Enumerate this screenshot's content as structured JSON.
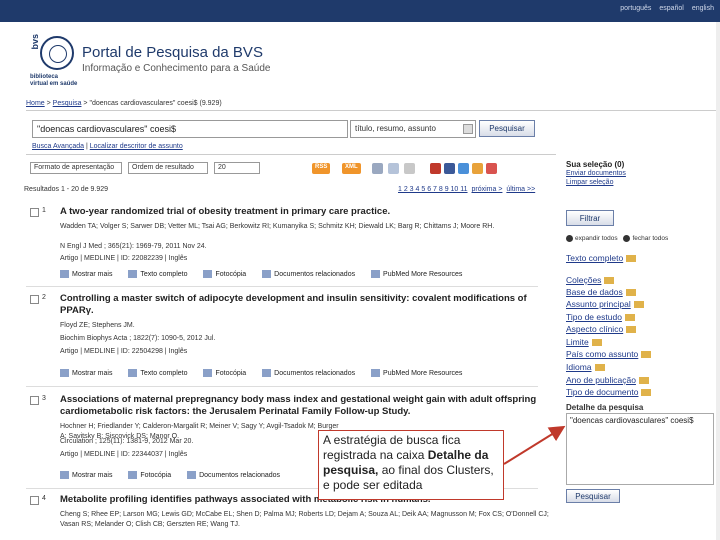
{
  "top": {
    "langs": [
      "português",
      "español",
      "english"
    ]
  },
  "header": {
    "logo_letters": "bvs",
    "logo_sub": [
      "biblioteca",
      "virtual em saúde"
    ],
    "title": "Portal de Pesquisa da BVS",
    "subtitle": "Informação e Conhecimento para a Saúde"
  },
  "breadcrumb": {
    "home": "Home",
    "pesquisa": "Pesquisa",
    "query_text": "> \"doencas cardiovasculares\" coesi$ (9.929)"
  },
  "search": {
    "value": "\"doencas cardiovasculares\" coesi$",
    "field_selected": "título, resumo, assunto",
    "button": "Pesquisar",
    "advanced": "Busca Avançada",
    "descriptor": "Localizar descritor de assunto"
  },
  "controls": {
    "format": "Formato de apresentação",
    "order": "Ordem de resultado",
    "per_page": "20",
    "rss": "RSS",
    "xml": "XML"
  },
  "results_count": "Resultados 1 - 20 de 9.929",
  "pager": {
    "pages": "1 2 3 4 5 6 7 8 9 10 11",
    "prev": "próxima >",
    "last": "última >>"
  },
  "results": [
    {
      "num": "1",
      "title": "A two-year randomized trial of obesity treatment in primary care practice.",
      "authors": "Wadden TA; Volger S; Sarwer DB; Vetter ML; Tsai AG; Berkowitz RI; Kumanyika S; Schmitz KH; Diewald LK; Barg R; Chittams J; Moore RH.",
      "journal": "N Engl J Med ; 365(21): 1969-79, 2011 Nov 24.",
      "meta": "Artigo | MEDLINE | ID: 22082239 | Inglês"
    },
    {
      "num": "2",
      "title": "Controlling a master switch of adipocyte development and insulin sensitivity: covalent modifications of PPARγ.",
      "authors": "Floyd ZE; Stephens JM.",
      "journal": "Biochim Biophys Acta ; 1822(7): 1090-5, 2012 Jul.",
      "meta": "Artigo | MEDLINE | ID: 22504298 | Inglês"
    },
    {
      "num": "3",
      "title": "Associations of maternal prepregnancy body mass index and gestational weight gain with adult offspring cardiometabolic risk factors: the Jerusalem Perinatal Family Follow-up Study.",
      "authors": "Hochner H; Friedlander Y; Calderon-Margalit R; Meiner V; Sagy Y; Avgil-Tsadok M; Burger A; Savitsky B; Siscovick DS; Manor O.",
      "journal": "Circulation ; 125(11): 1381-9, 2012 Mar 20.",
      "meta": "Artigo | MEDLINE | ID: 22344037 | Inglês"
    },
    {
      "num": "4",
      "title": "Metabolite profiling identifies pathways associated with metabolic risk in humans.",
      "authors": "Cheng S; Rhee EP; Larson MG; Lewis GD; McCabe EL; Shen D; Palma MJ; Roberts LD; Dejam A; Souza AL; Deik AA; Magnusson M; Fox CS; O'Donnell CJ; Vasan RS; Melander O; Clish CB; Gerszten RE; Wang TJ."
    }
  ],
  "result_links": [
    "Mostrar mais",
    "Texto completo",
    "Fotocópia",
    "Documentos relacionados",
    "PubMed More Resources"
  ],
  "sidebar": {
    "selection_title": "Sua seleção (0)",
    "send": "Enviar documentos",
    "clear": "Limpar seleção",
    "filter": "Filtrar",
    "expand": "expandir todos",
    "collapse": "fechar todos",
    "clusters": [
      "Texto completo",
      "Coleções",
      "Base de dados",
      "Assunto principal",
      "Tipo de estudo",
      "Aspecto clínico",
      "Limite",
      "País como assunto",
      "Idioma",
      "Ano de publicação",
      "Tipo de documento"
    ],
    "detail_title": "Detalhe da pesquisa",
    "detail_value": "\"doencas cardiovasculares\" coesi$",
    "search_btn": "Pesquisar"
  },
  "callout": {
    "part1": "A estratégia de busca  fica registrada na caixa ",
    "bold": "Detalhe da pesquisa,",
    "part2": " ao final dos Clusters, e pode ser editada"
  },
  "colors": {
    "brand": "#1f3a6b",
    "link": "#1f3a8a",
    "callout_border": "#c0392b"
  }
}
